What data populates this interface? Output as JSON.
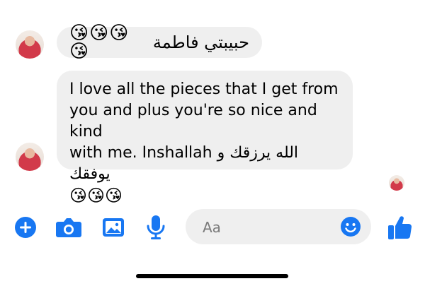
{
  "messages": [
    {
      "emoji": "😘😘😘😘",
      "text": "حبيبتي فاطمة"
    },
    {
      "text_lines": [
        "I love all the pieces that I get from",
        "you and plus you're so nice and kind",
        "with me. Inshallah الله يرزقك و يوفقك"
      ],
      "emoji": "😘😘😘"
    }
  ],
  "composer": {
    "placeholder": "Aa"
  },
  "colors": {
    "accent": "#1877f2",
    "bubble": "#efefef"
  },
  "icons": [
    "plus-icon",
    "camera-icon",
    "image-icon",
    "microphone-icon",
    "emoji-icon",
    "thumbs-up-icon"
  ]
}
